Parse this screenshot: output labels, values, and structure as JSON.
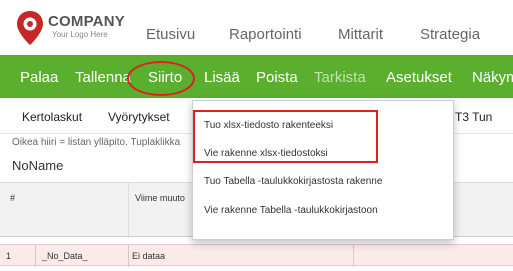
{
  "brand": {
    "name": "COMPANY",
    "slogan": "Your Logo Here",
    "logo_color": "#c62828"
  },
  "top_nav": [
    "Etusivu",
    "Raportointi",
    "Mittarit",
    "Strategia"
  ],
  "toolbar": {
    "background": "#5aaf2e",
    "items": [
      {
        "label": "Palaa",
        "enabled": true
      },
      {
        "label": "Tallenna",
        "enabled": true
      },
      {
        "label": "Siirto",
        "enabled": true
      },
      {
        "label": "Lisää",
        "enabled": true
      },
      {
        "label": "Poista",
        "enabled": true
      },
      {
        "label": "Tarkista",
        "enabled": false
      },
      {
        "label": "Asetukset",
        "enabled": true
      },
      {
        "label": "Näkym",
        "enabled": true
      }
    ]
  },
  "tabs": [
    "Kertolaskut",
    "Vyörytykset",
    "T3 Tun"
  ],
  "hint": "Oikea hiiri = listan ylläpito. Tuplaklikka",
  "section_title": "NoName",
  "table": {
    "headers": [
      "#",
      "Viime muuto"
    ],
    "rows": [
      {
        "num": "1",
        "name": "_No_Data_",
        "value": "Ei dataa"
      }
    ]
  },
  "dropdown": {
    "items": [
      "Tuo xlsx-tiedosto rakenteeksi",
      "Vie rakenne xlsx-tiedostoksi",
      "Tuo Tabella -taulukkokirjastosta rakenne",
      "Vie rakenne Tabella -taulukkokirjastoon"
    ]
  },
  "annotation_color": "#e02020"
}
